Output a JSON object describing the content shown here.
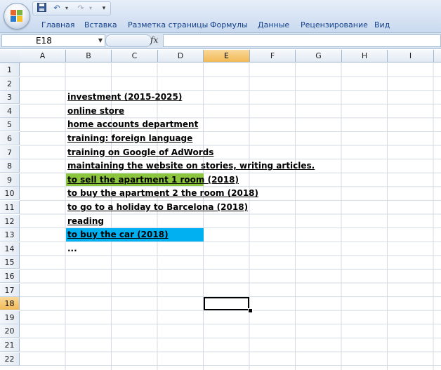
{
  "app": {
    "office_button": "office-logo",
    "quick_access": {
      "save_icon": "save-icon",
      "undo_icon": "undo-icon",
      "redo_icon": "redo-icon",
      "customize_icon": "customize-qat-icon"
    },
    "tabs": [
      {
        "label": "Главная"
      },
      {
        "label": "Вставка"
      },
      {
        "label": "Разметка страницы"
      },
      {
        "label": "Формулы"
      },
      {
        "label": "Данные"
      },
      {
        "label": "Рецензирование"
      },
      {
        "label": "Вид"
      }
    ]
  },
  "formula_bar": {
    "name_box": "E18",
    "fx_label": "fx",
    "formula": ""
  },
  "grid": {
    "columns": [
      "A",
      "B",
      "C",
      "D",
      "E",
      "F",
      "G",
      "H",
      "I"
    ],
    "active_column": "E",
    "rows": [
      "1",
      "2",
      "3",
      "4",
      "5",
      "6",
      "7",
      "8",
      "9",
      "10",
      "11",
      "12",
      "13",
      "14",
      "15",
      "16",
      "17",
      "18",
      "19",
      "20",
      "21",
      "22"
    ],
    "active_row": "18",
    "cells": [
      {
        "ref": "B3",
        "text": "investment (2015-2025)",
        "underline": true
      },
      {
        "ref": "B4",
        "text": "online store",
        "underline": true
      },
      {
        "ref": "B5",
        "text": "home accounts department",
        "underline": true
      },
      {
        "ref": "B6",
        "text": "training: foreign language",
        "underline": true
      },
      {
        "ref": "B7",
        "text": "training on Google of AdWords",
        "underline": true
      },
      {
        "ref": "B8",
        "text": "maintaining the website on stories, writing articles.",
        "underline": true
      },
      {
        "ref": "B9",
        "text": "to sell the apartment 1 room (2018)",
        "underline": true,
        "fill": "#8cc63e"
      },
      {
        "ref": "B10",
        "text": "to buy the apartment 2 the room (2018)",
        "underline": true
      },
      {
        "ref": "B11",
        "text": "to go to a holiday to Barcelona (2018)",
        "underline": true
      },
      {
        "ref": "B12",
        "text": "reading",
        "underline": true
      },
      {
        "ref": "B13",
        "text": "to buy the car (2018)",
        "underline": true,
        "fill": "#00b0f0"
      },
      {
        "ref": "B14",
        "text": "...",
        "underline": false
      }
    ],
    "selected_cell": "E18"
  },
  "colors": {
    "ribbon_text": "#15428b",
    "active_header": "#f2b955",
    "green_fill": "#8cc63e",
    "blue_fill": "#00b0f0"
  }
}
